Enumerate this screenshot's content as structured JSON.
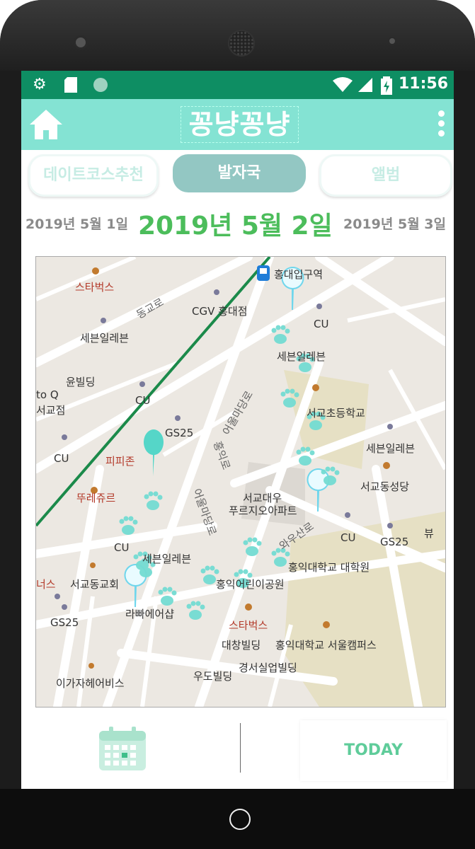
{
  "status": {
    "time": "11:56"
  },
  "appbar": {
    "title": "꽁냥꽁냥"
  },
  "tabs": [
    {
      "label": "데이트코스추천"
    },
    {
      "label": "발자국"
    },
    {
      "label": "앨범"
    }
  ],
  "dates": {
    "prev": "2019년 5월 1일",
    "current": "2019년 5월 2일",
    "next": "2019년 5월 3일"
  },
  "map": {
    "labels": {
      "starbucks1": "스타벅스",
      "cgv": "CGV 홍대점",
      "station": "홍대입구역",
      "cu1": "CU",
      "seven1": "세븐일레븐",
      "seven2": "세븐일레븐",
      "yunbuilding": "윤빌딩",
      "q": "to Q",
      "gyojeom": "서교점",
      "cu2": "CU",
      "gs25a": "GS25",
      "school": "서교초등학교",
      "cu3": "CU",
      "pizza": "피피존",
      "seven3": "세븐일레븐",
      "tous": "뚜레쥬르",
      "daewoo1": "서교대우",
      "daewoo2": "푸르지오아파트",
      "church1": "서교동성당",
      "cu4": "CU",
      "seven4": "세븐일레븐",
      "cu5": "CU",
      "gs25b": "GS25",
      "hongik": "홍익대학교 대학원",
      "ners": "너스",
      "church2": "서교동교회",
      "park": "홍익어린이공원",
      "hair": "라빠에어샵",
      "gs25c": "GS25",
      "starbucks2": "스타벅스",
      "daechang": "대창빌딩",
      "hongikseoul": "홍익대학교 서울캠퍼스",
      "gyeongseo": "경서실업빌딩",
      "udo": "우도빌딩",
      "igaja": "이가자헤어비스",
      "road1": "동교로",
      "road2": "어울마당로",
      "road3": "홍익로",
      "road4": "와우산로",
      "road5": "어울마당로",
      "view": "뷰"
    }
  },
  "bottom": {
    "today_label": "TODAY"
  }
}
